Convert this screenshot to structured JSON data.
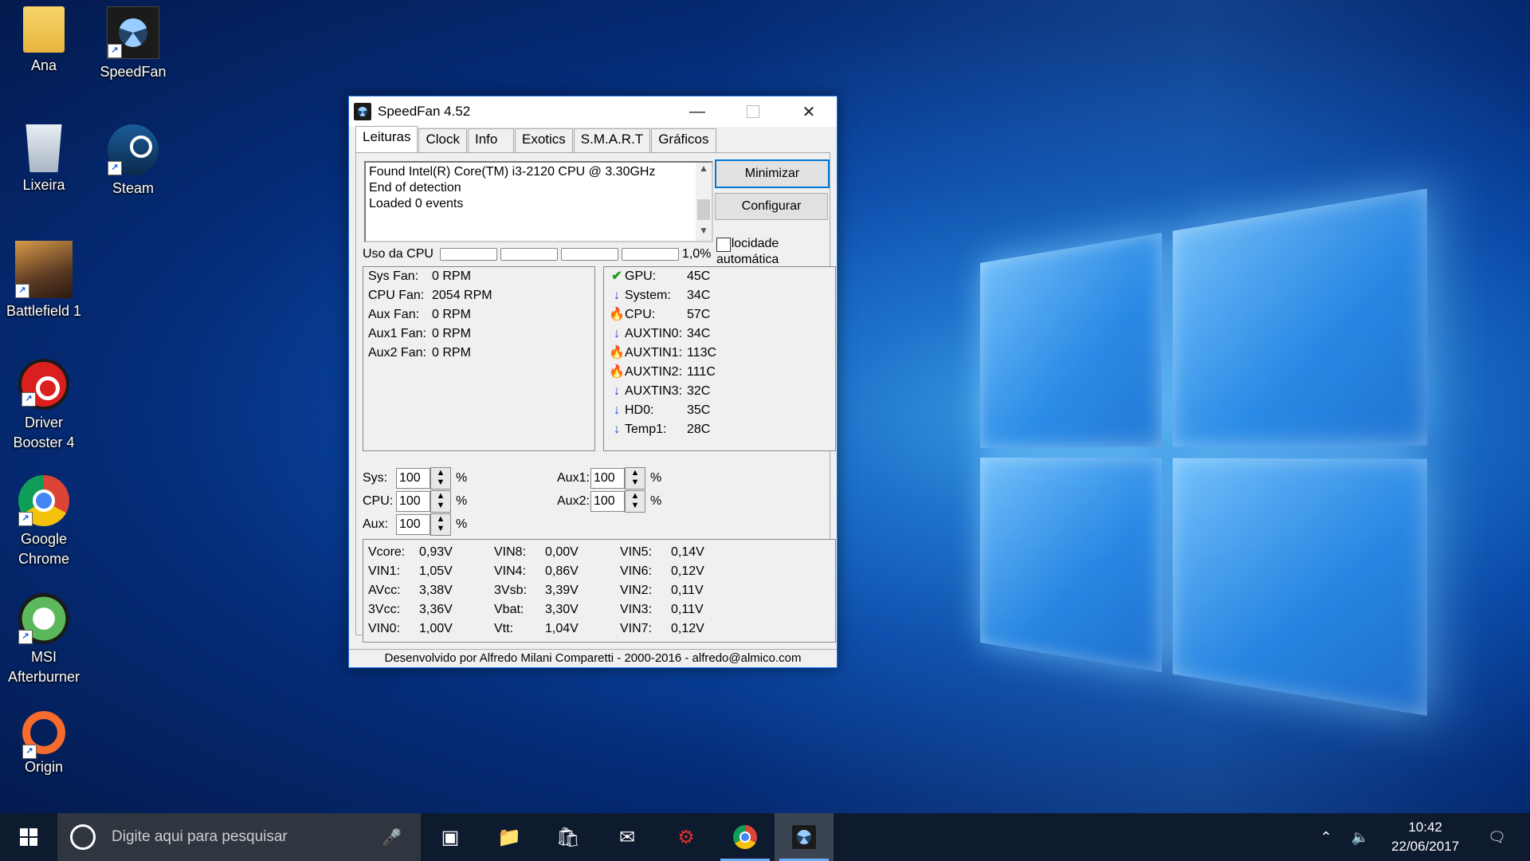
{
  "desktop": {
    "icons": [
      {
        "label": "Ana"
      },
      {
        "label": "SpeedFan"
      },
      {
        "label": "Lixeira"
      },
      {
        "label": "Steam"
      },
      {
        "label": "Battlefield 1"
      },
      {
        "label": "Driver Booster 4"
      },
      {
        "label": "Google Chrome"
      },
      {
        "label": "MSI Afterburner"
      },
      {
        "label": "Origin"
      }
    ]
  },
  "window": {
    "title": "SpeedFan 4.52",
    "tabs": [
      "Leituras",
      "Clock",
      "Info",
      "Exotics",
      "S.M.A.R.T",
      "Gráficos"
    ],
    "log_lines": [
      "Found Intel(R) Core(TM) i3-2120 CPU @ 3.30GHz",
      "End of detection",
      "Loaded 0 events"
    ],
    "buttons": {
      "minimize": "Minimizar",
      "configure": "Configurar"
    },
    "auto_speed_label": "Velocidade automática",
    "cpu_usage": {
      "label": "Uso da CPU",
      "value": "1,0%"
    },
    "fans": [
      {
        "k": "Sys Fan:",
        "v": "0 RPM"
      },
      {
        "k": "CPU Fan:",
        "v": "2054 RPM"
      },
      {
        "k": "Aux Fan:",
        "v": "0 RPM"
      },
      {
        "k": "Aux1 Fan:",
        "v": "0 RPM"
      },
      {
        "k": "Aux2 Fan:",
        "v": "0 RPM"
      }
    ],
    "temps": [
      {
        "k": "GPU:",
        "v": "45C",
        "status": "ok"
      },
      {
        "k": "System:",
        "v": "34C",
        "status": "down"
      },
      {
        "k": "CPU:",
        "v": "57C",
        "status": "hot"
      },
      {
        "k": "AUXTIN0:",
        "v": "34C",
        "status": "down"
      },
      {
        "k": "AUXTIN1:",
        "v": "113C",
        "status": "hot"
      },
      {
        "k": "AUXTIN2:",
        "v": "111C",
        "status": "hot"
      },
      {
        "k": "AUXTIN3:",
        "v": "32C",
        "status": "down"
      },
      {
        "k": "HD0:",
        "v": "35C",
        "status": "down"
      },
      {
        "k": "Temp1:",
        "v": "28C",
        "status": "down"
      }
    ],
    "speeds": [
      {
        "label": "Sys:",
        "value": "100",
        "unit": "%"
      },
      {
        "label": "CPU:",
        "value": "100",
        "unit": "%"
      },
      {
        "label": "Aux:",
        "value": "100",
        "unit": "%"
      },
      {
        "label": "Aux1:",
        "value": "100",
        "unit": "%"
      },
      {
        "label": "Aux2:",
        "value": "100",
        "unit": "%"
      }
    ],
    "voltages": [
      [
        {
          "k": "Vcore:",
          "v": "0,93V"
        },
        {
          "k": "VIN1:",
          "v": "1,05V"
        },
        {
          "k": "AVcc:",
          "v": "3,38V"
        },
        {
          "k": "3Vcc:",
          "v": "3,36V"
        },
        {
          "k": "VIN0:",
          "v": "1,00V"
        }
      ],
      [
        {
          "k": "VIN8:",
          "v": "0,00V"
        },
        {
          "k": "VIN4:",
          "v": "0,86V"
        },
        {
          "k": "3Vsb:",
          "v": "3,39V"
        },
        {
          "k": "Vbat:",
          "v": "3,30V"
        },
        {
          "k": "Vtt:",
          "v": "1,04V"
        }
      ],
      [
        {
          "k": "VIN5:",
          "v": "0,14V"
        },
        {
          "k": "VIN6:",
          "v": "0,12V"
        },
        {
          "k": "VIN2:",
          "v": "0,11V"
        },
        {
          "k": "VIN3:",
          "v": "0,11V"
        },
        {
          "k": "VIN7:",
          "v": "0,12V"
        }
      ]
    ],
    "footer": "Desenvolvido por Alfredo Milani Comparetti - 2000-2016 - alfredo@almico.com"
  },
  "taskbar": {
    "search_placeholder": "Digite aqui para pesquisar",
    "time": "10:42",
    "date": "22/06/2017"
  },
  "colors": {
    "accent": "#0078d7",
    "taskbar": "#0e1a2e",
    "ok": "#1a9a1a",
    "down": "#1c3fd6",
    "hot": "#e0441a"
  }
}
